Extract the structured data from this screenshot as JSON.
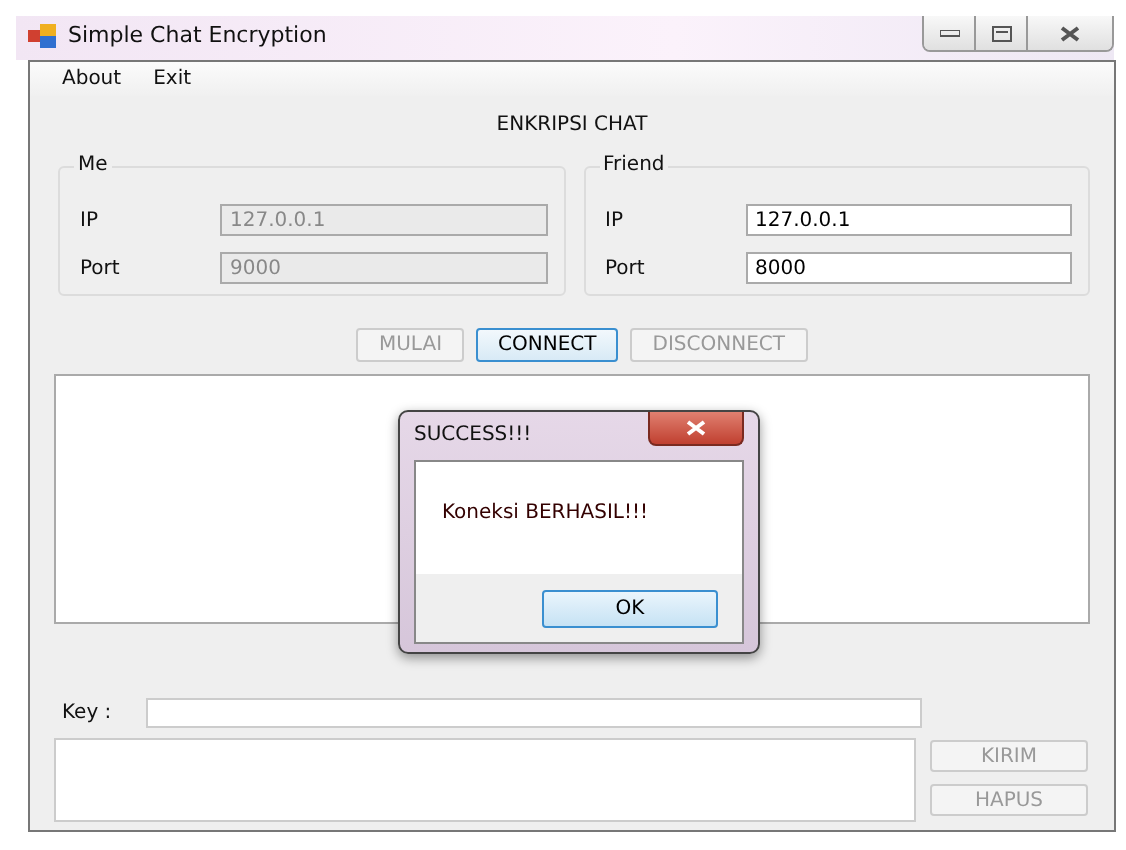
{
  "window": {
    "title": "Simple Chat Encryption"
  },
  "menu": [
    {
      "label": "About"
    },
    {
      "label": "Exit"
    }
  ],
  "heading": "ENKRIPSI CHAT",
  "groups": [
    {
      "title": "Me",
      "fields": [
        {
          "label": "IP",
          "value": "127.0.0.1",
          "disabled": true
        },
        {
          "label": "Port",
          "value": "9000",
          "disabled": true
        }
      ]
    },
    {
      "title": "Friend",
      "fields": [
        {
          "label": "IP",
          "value": "127.0.0.1",
          "disabled": false
        },
        {
          "label": "Port",
          "value": "8000",
          "disabled": false
        }
      ]
    }
  ],
  "buttons": [
    {
      "label": "MULAI",
      "disabled": true
    },
    {
      "label": "CONNECT",
      "disabled": false
    },
    {
      "label": "DISCONNECT",
      "disabled": true
    }
  ],
  "key": {
    "label": "Key :"
  },
  "send_buttons": [
    {
      "label": "KIRIM",
      "disabled": true
    },
    {
      "label": "HAPUS",
      "disabled": true
    }
  ],
  "dialog": {
    "title": "SUCCESS!!!",
    "message": "Koneksi BERHASIL!!!",
    "button": "OK"
  }
}
